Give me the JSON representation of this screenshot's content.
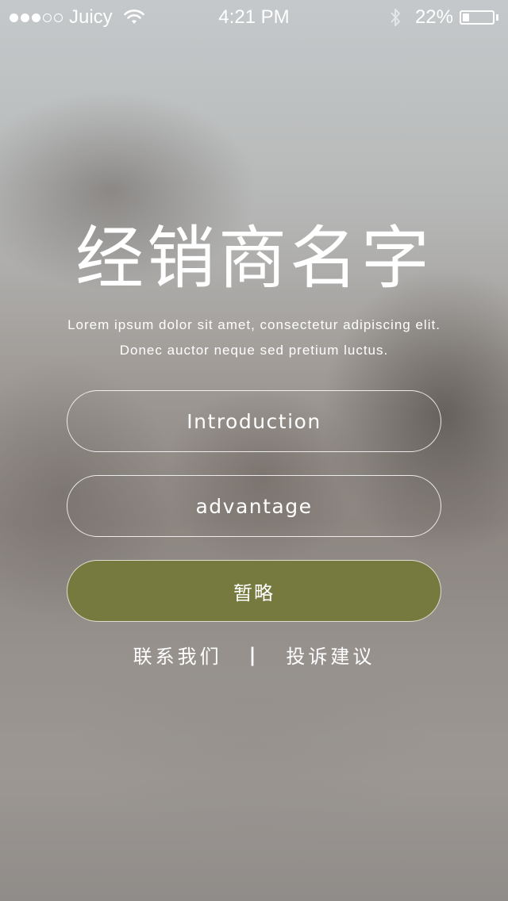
{
  "status_bar": {
    "carrier": "Juicy",
    "time": "4:21 PM",
    "battery_percent": "22%",
    "battery_level": 0.22,
    "signal_filled": 3,
    "signal_total": 5
  },
  "hero": {
    "title": "经销商名字",
    "subtitle_line1": "Lorem ipsum dolor sit amet, consectetur adipiscing elit.",
    "subtitle_line2": "Donec auctor neque sed pretium luctus."
  },
  "buttons": {
    "introduction": "Introduction",
    "advantage": "advantage",
    "browse": "暂略"
  },
  "links": {
    "contact": "联系我们",
    "separator": "|",
    "complaint": "投诉建议"
  },
  "colors": {
    "primary_button": "#767a3f",
    "text": "#ffffff"
  }
}
